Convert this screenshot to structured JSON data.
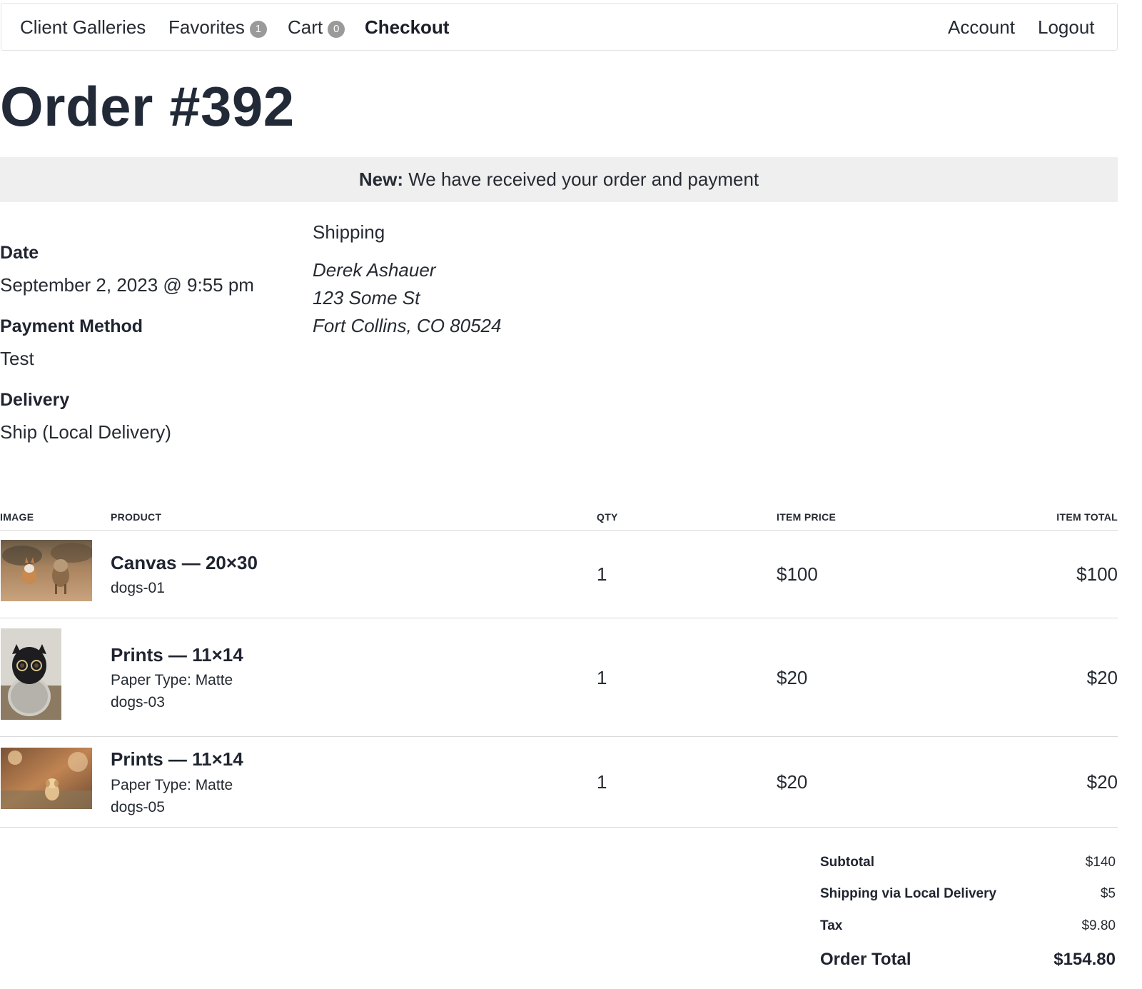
{
  "nav": {
    "client_galleries": "Client Galleries",
    "favorites": "Favorites",
    "favorites_count": "1",
    "cart": "Cart",
    "cart_count": "0",
    "checkout": "Checkout",
    "account": "Account",
    "logout": "Logout"
  },
  "order": {
    "title": "Order #392",
    "status_label": "New:",
    "status_text": "We have received your order and payment",
    "date_label": "Date",
    "date_value": "September 2, 2023 @ 9:55 pm",
    "payment_label": "Payment Method",
    "payment_value": "Test",
    "delivery_label": "Delivery",
    "delivery_value": "Ship (Local Delivery)"
  },
  "shipping": {
    "heading": "Shipping",
    "name": "Derek Ashauer",
    "street": "123 Some St",
    "city": "Fort Collins, CO 80524"
  },
  "table": {
    "headers": {
      "image": "IMAGE",
      "product": "PRODUCT",
      "qty": "QTY",
      "price": "ITEM PRICE",
      "total": "ITEM TOTAL"
    },
    "rows": [
      {
        "name": "Canvas — 20×30",
        "option": "",
        "file": "dogs-01",
        "qty": "1",
        "price": "$100",
        "total": "$100",
        "image": "dogs-01-photo"
      },
      {
        "name": "Prints — 11×14",
        "option": "Paper Type: Matte",
        "file": "dogs-03",
        "qty": "1",
        "price": "$20",
        "total": "$20",
        "image": "dogs-03-photo"
      },
      {
        "name": "Prints — 11×14",
        "option": "Paper Type: Matte",
        "file": "dogs-05",
        "qty": "1",
        "price": "$20",
        "total": "$20",
        "image": "dogs-05-photo"
      }
    ]
  },
  "totals": {
    "subtotal_label": "Subtotal",
    "subtotal_value": "$140",
    "shipping_label": "Shipping via Local Delivery",
    "shipping_value": "$5",
    "tax_label": "Tax",
    "tax_value": "$9.80",
    "total_label": "Order Total",
    "total_value": "$154.80"
  },
  "colors": {
    "heading": "#222a38",
    "notice_bg": "#efefef",
    "badge": "#9a9a9a",
    "rule": "#d9d9d9"
  }
}
